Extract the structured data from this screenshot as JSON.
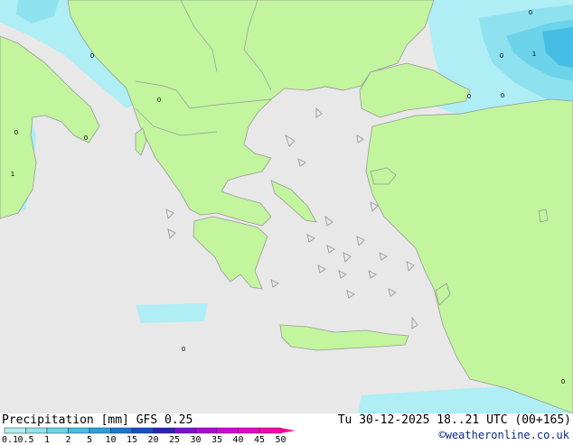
{
  "header": {
    "left": "Precipitation [mm]  GFS 0.25",
    "right": "Tu 30-12-2025 18..21 UTC (00+165)"
  },
  "credit": "©weatheronline.co.uk",
  "legend": {
    "ticks": [
      "0.1",
      "0.5",
      "1",
      "2",
      "5",
      "10",
      "15",
      "20",
      "25",
      "30",
      "35",
      "40",
      "45",
      "50"
    ],
    "colors": [
      "#f0f0f0",
      "#aeeef4",
      "#8ee2ef",
      "#6bd3ea",
      "#46bde4",
      "#2a9fdb",
      "#1c77cc",
      "#1450bf",
      "#2a23b8",
      "#7a10c9",
      "#a90ad0",
      "#cf08d3",
      "#e706c9",
      "#f505b0",
      "#ff0090"
    ]
  },
  "map": {
    "sea_color": "#e8e8e8",
    "land_color": "#c2f59e",
    "precip_light": "#aeeef4",
    "precip_mid": "#6bd3ea",
    "precip_heavy": "#2a9fdb",
    "cell_values": [
      "0",
      "0",
      "0",
      "0",
      "0",
      "1",
      "1",
      "0",
      "0",
      "0",
      "0",
      "0"
    ]
  }
}
